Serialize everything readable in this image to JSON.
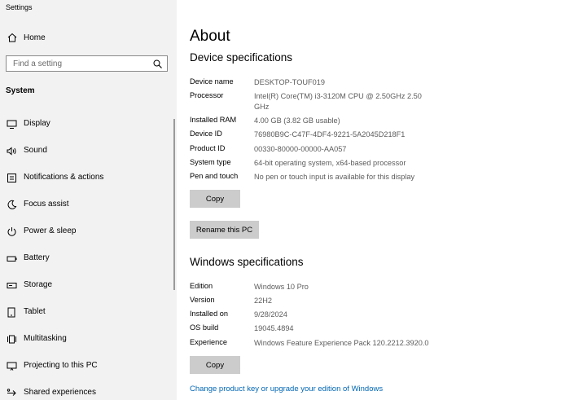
{
  "app": {
    "title": "Settings"
  },
  "sidebar": {
    "home_label": "Home",
    "search": {
      "placeholder": "Find a setting"
    },
    "section_label": "System",
    "items": [
      {
        "label": "Display",
        "icon": "display-icon"
      },
      {
        "label": "Sound",
        "icon": "sound-icon"
      },
      {
        "label": "Notifications & actions",
        "icon": "notifications-icon"
      },
      {
        "label": "Focus assist",
        "icon": "focus-assist-icon"
      },
      {
        "label": "Power & sleep",
        "icon": "power-icon"
      },
      {
        "label": "Battery",
        "icon": "battery-icon"
      },
      {
        "label": "Storage",
        "icon": "storage-icon"
      },
      {
        "label": "Tablet",
        "icon": "tablet-icon"
      },
      {
        "label": "Multitasking",
        "icon": "multitasking-icon"
      },
      {
        "label": "Projecting to this PC",
        "icon": "projecting-icon"
      },
      {
        "label": "Shared experiences",
        "icon": "shared-experiences-icon"
      }
    ]
  },
  "main": {
    "title": "About",
    "device_specs": {
      "heading": "Device specifications",
      "rows": [
        {
          "label": "Device name",
          "value": "DESKTOP-TOUF019"
        },
        {
          "label": "Processor",
          "value": "Intel(R) Core(TM) i3-3120M CPU @ 2.50GHz   2.50 GHz"
        },
        {
          "label": "Installed RAM",
          "value": "4.00 GB (3.82 GB usable)"
        },
        {
          "label": "Device ID",
          "value": "76980B9C-C47F-4DF4-9221-5A2045D218F1"
        },
        {
          "label": "Product ID",
          "value": "00330-80000-00000-AA057"
        },
        {
          "label": "System type",
          "value": "64-bit operating system, x64-based processor"
        },
        {
          "label": "Pen and touch",
          "value": "No pen or touch input is available for this display"
        }
      ],
      "copy_label": "Copy",
      "rename_label": "Rename this PC"
    },
    "windows_specs": {
      "heading": "Windows specifications",
      "rows": [
        {
          "label": "Edition",
          "value": "Windows 10 Pro"
        },
        {
          "label": "Version",
          "value": "22H2"
        },
        {
          "label": "Installed on",
          "value": "9/28/2024"
        },
        {
          "label": "OS build",
          "value": "19045.4894"
        },
        {
          "label": "Experience",
          "value": "Windows Feature Experience Pack 120.2212.3920.0"
        }
      ],
      "copy_label": "Copy"
    },
    "upgrade_link": "Change product key or upgrade your edition of Windows"
  }
}
